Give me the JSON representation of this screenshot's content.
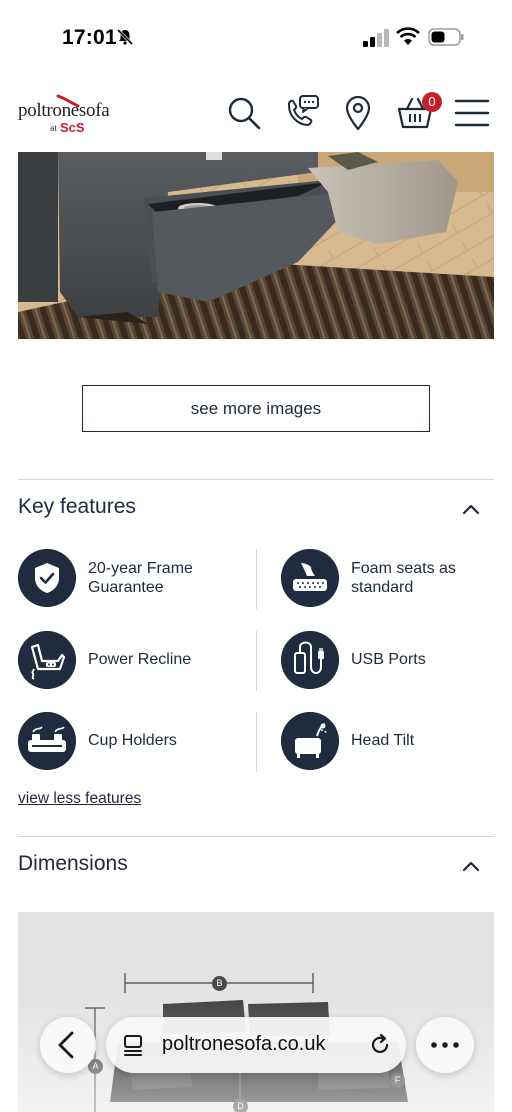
{
  "status_bar": {
    "time": "17:01",
    "icons": [
      "bell-muted-icon",
      "signal-icon",
      "wifi-icon",
      "battery-icon"
    ]
  },
  "header": {
    "logo": {
      "brand": "poltronesofa",
      "at": "at",
      "partner": "ScS"
    },
    "icons": [
      "search-icon",
      "phone-chat-icon",
      "location-pin-icon",
      "basket-icon",
      "menu-icon"
    ],
    "cart_count": "0"
  },
  "gallery": {
    "see_more_label": "see more images"
  },
  "key_features": {
    "title": "Key features",
    "items": [
      {
        "label": "20-year Frame Guarantee",
        "icon": "shield-check-icon"
      },
      {
        "label": "Foam seats as standard",
        "icon": "foam-seat-icon"
      },
      {
        "label": "Power Recline",
        "icon": "power-recline-icon"
      },
      {
        "label": "USB Ports",
        "icon": "usb-port-icon"
      },
      {
        "label": "Cup Holders",
        "icon": "cup-holder-icon"
      },
      {
        "label": "Head Tilt",
        "icon": "head-tilt-icon"
      }
    ],
    "view_less_label": "view less features"
  },
  "dimensions": {
    "title": "Dimensions",
    "markers": [
      "A",
      "B",
      "D",
      "F"
    ]
  },
  "browser": {
    "url": "poltronesofa.co.uk",
    "icons": [
      "back-icon",
      "tabs-icon",
      "reload-icon",
      "more-icon"
    ]
  },
  "colors": {
    "navy": "#1f2b3e",
    "brand_red": "#c8202a",
    "divider": "#d6d6d6"
  }
}
